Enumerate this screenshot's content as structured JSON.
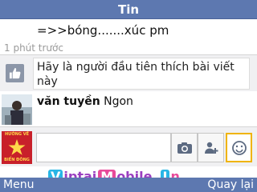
{
  "header": {
    "title": "Tin"
  },
  "post": {
    "body": "=>>bóng.......xúc pm",
    "time": "1 phút trước"
  },
  "like_row": {
    "icon": "thumbs-up-icon",
    "prompt": "Hãy là người đầu tiên thích bài viết này"
  },
  "comment": {
    "author": "văn tuyền",
    "text": "Ngon"
  },
  "compose": {
    "avatar_caption_top": "HƯỚNG VỀ",
    "avatar_caption_bottom": "BIỂN ĐÔNG",
    "tools": [
      "camera-icon",
      "tag-friend-icon",
      "emoji-icon"
    ]
  },
  "watermark": {
    "parts": [
      "V",
      "iptai",
      "M",
      "obile",
      ".",
      "I",
      "n"
    ]
  },
  "softkeys": {
    "left": "Menu",
    "right": "Quay lại"
  },
  "colors": {
    "bar": "#5d78b0",
    "accent": "#f0b400",
    "flag_red": "#c8202a"
  }
}
